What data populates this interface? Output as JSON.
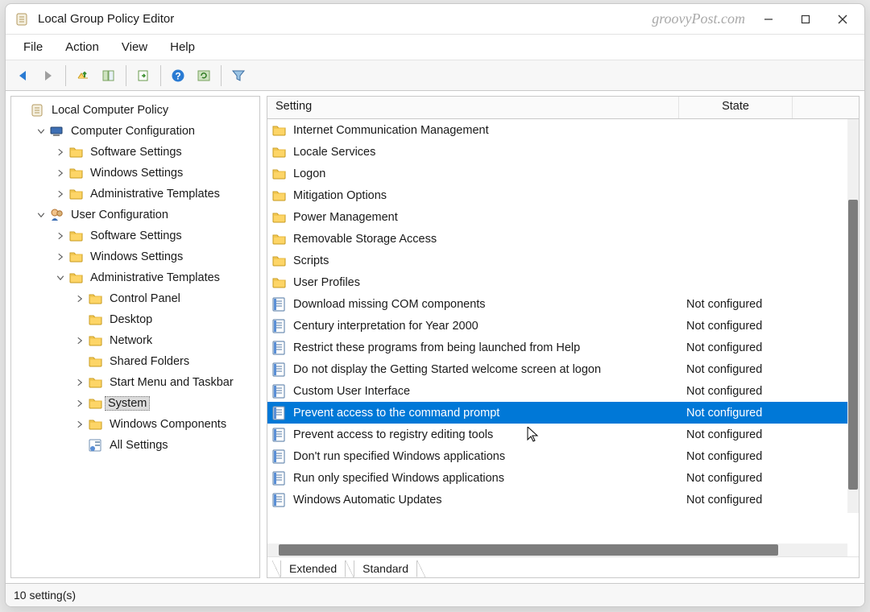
{
  "window": {
    "title": "Local Group Policy Editor",
    "watermark": "groovyPost.com"
  },
  "menu": [
    "File",
    "Action",
    "View",
    "Help"
  ],
  "statusbar": "10 setting(s)",
  "tree": [
    {
      "depth": 0,
      "exp": "none",
      "icon": "policy-scroll",
      "label": "Local Computer Policy",
      "sel": false
    },
    {
      "depth": 1,
      "exp": "open",
      "icon": "computer",
      "label": "Computer Configuration",
      "sel": false
    },
    {
      "depth": 2,
      "exp": "closed",
      "icon": "folder",
      "label": "Software Settings",
      "sel": false
    },
    {
      "depth": 2,
      "exp": "closed",
      "icon": "folder",
      "label": "Windows Settings",
      "sel": false
    },
    {
      "depth": 2,
      "exp": "closed",
      "icon": "folder",
      "label": "Administrative Templates",
      "sel": false
    },
    {
      "depth": 1,
      "exp": "open",
      "icon": "user",
      "label": "User Configuration",
      "sel": false
    },
    {
      "depth": 2,
      "exp": "closed",
      "icon": "folder",
      "label": "Software Settings",
      "sel": false
    },
    {
      "depth": 2,
      "exp": "closed",
      "icon": "folder",
      "label": "Windows Settings",
      "sel": false
    },
    {
      "depth": 2,
      "exp": "open",
      "icon": "folder",
      "label": "Administrative Templates",
      "sel": false
    },
    {
      "depth": 3,
      "exp": "closed",
      "icon": "folder",
      "label": "Control Panel",
      "sel": false
    },
    {
      "depth": 3,
      "exp": "none",
      "icon": "folder",
      "label": "Desktop",
      "sel": false
    },
    {
      "depth": 3,
      "exp": "closed",
      "icon": "folder",
      "label": "Network",
      "sel": false
    },
    {
      "depth": 3,
      "exp": "none",
      "icon": "folder",
      "label": "Shared Folders",
      "sel": false
    },
    {
      "depth": 3,
      "exp": "closed",
      "icon": "folder",
      "label": "Start Menu and Taskbar",
      "sel": false
    },
    {
      "depth": 3,
      "exp": "closed",
      "icon": "folder",
      "label": "System",
      "sel": true
    },
    {
      "depth": 3,
      "exp": "closed",
      "icon": "folder",
      "label": "Windows Components",
      "sel": false
    },
    {
      "depth": 3,
      "exp": "none",
      "icon": "all-settings",
      "label": "All Settings",
      "sel": false
    }
  ],
  "columns": {
    "setting": "Setting",
    "state": "State"
  },
  "items": [
    {
      "icon": "folder",
      "label": "Internet Communication Management",
      "state": "",
      "sel": false
    },
    {
      "icon": "folder",
      "label": "Locale Services",
      "state": "",
      "sel": false
    },
    {
      "icon": "folder",
      "label": "Logon",
      "state": "",
      "sel": false
    },
    {
      "icon": "folder",
      "label": "Mitigation Options",
      "state": "",
      "sel": false
    },
    {
      "icon": "folder",
      "label": "Power Management",
      "state": "",
      "sel": false
    },
    {
      "icon": "folder",
      "label": "Removable Storage Access",
      "state": "",
      "sel": false
    },
    {
      "icon": "folder",
      "label": "Scripts",
      "state": "",
      "sel": false
    },
    {
      "icon": "folder",
      "label": "User Profiles",
      "state": "",
      "sel": false
    },
    {
      "icon": "setting",
      "label": "Download missing COM components",
      "state": "Not configured",
      "sel": false
    },
    {
      "icon": "setting",
      "label": "Century interpretation for Year 2000",
      "state": "Not configured",
      "sel": false
    },
    {
      "icon": "setting",
      "label": "Restrict these programs from being launched from Help",
      "state": "Not configured",
      "sel": false
    },
    {
      "icon": "setting",
      "label": "Do not display the Getting Started welcome screen at logon",
      "state": "Not configured",
      "sel": false
    },
    {
      "icon": "setting",
      "label": "Custom User Interface",
      "state": "Not configured",
      "sel": false
    },
    {
      "icon": "setting",
      "label": "Prevent access to the command prompt",
      "state": "Not configured",
      "sel": true
    },
    {
      "icon": "setting",
      "label": "Prevent access to registry editing tools",
      "state": "Not configured",
      "sel": false
    },
    {
      "icon": "setting",
      "label": "Don't run specified Windows applications",
      "state": "Not configured",
      "sel": false
    },
    {
      "icon": "setting",
      "label": "Run only specified Windows applications",
      "state": "Not configured",
      "sel": false
    },
    {
      "icon": "setting",
      "label": "Windows Automatic Updates",
      "state": "Not configured",
      "sel": false
    }
  ],
  "tabs": {
    "extended": "Extended",
    "standard": "Standard"
  }
}
